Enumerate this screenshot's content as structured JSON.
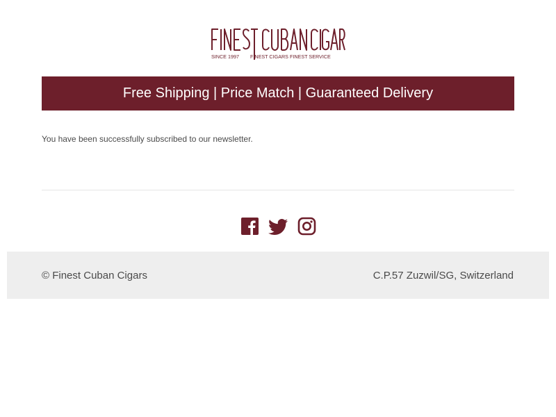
{
  "brand": {
    "logo_title": "FINEST CUBAN CIGARS",
    "logo_tagline": "SINCE 1997 | FINEST CIGARS FINEST SERVICE",
    "color": "#6d1f2b"
  },
  "banner": {
    "text": "Free Shipping | Price Match | Guaranteed Delivery",
    "background": "#6d1f2b"
  },
  "message": {
    "text": "You have been successfully subscribed to our newsletter."
  },
  "social": {
    "icons": [
      "facebook-icon",
      "twitter-icon",
      "instagram-icon"
    ]
  },
  "footer": {
    "copyright": "© Finest Cuban Cigars",
    "address": "C.P.57 Zuzwil/SG, Switzerland",
    "background": "#eeeeee"
  }
}
